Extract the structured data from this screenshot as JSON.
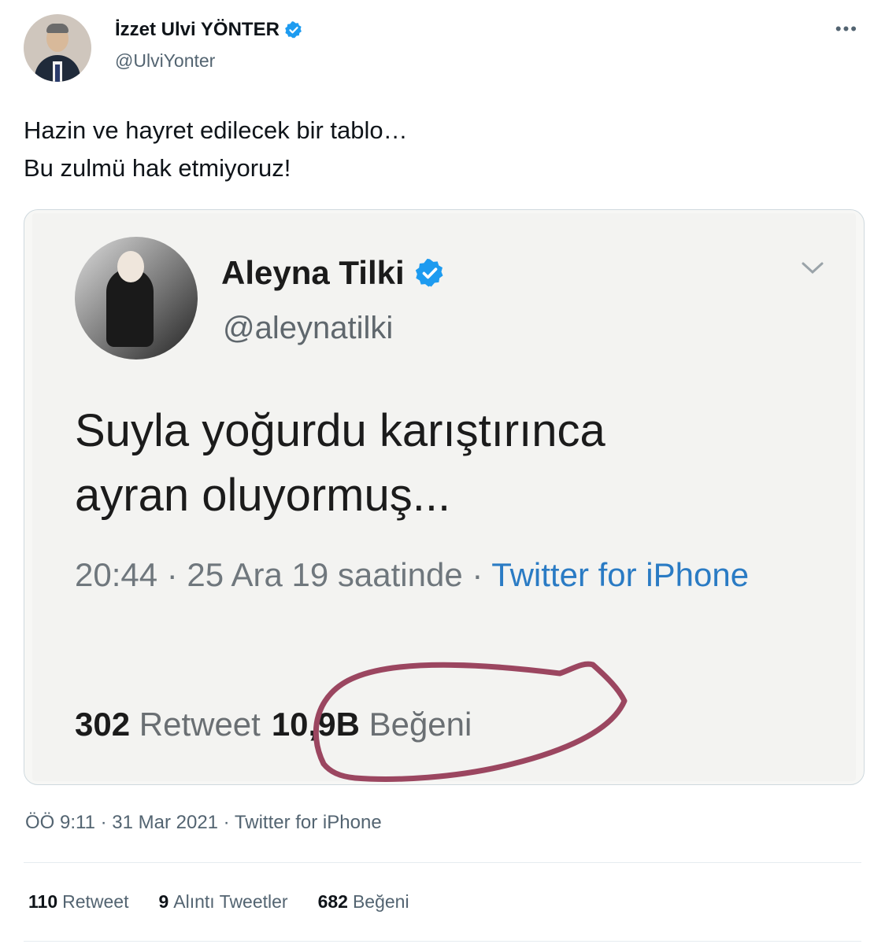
{
  "author": {
    "name": "İzzet Ulvi YÖNTER",
    "handle": "@UlviYonter"
  },
  "more_label": "•••",
  "tweet": {
    "lines": [
      "Hazin ve hayret edilecek bir tablo…",
      "Bu zulmü hak etmiyoruz!"
    ]
  },
  "embedded": {
    "name": "Aleyna Tilki",
    "handle": "@aleynatilki",
    "lines": [
      "Suyla yoğurdu karıştırınca",
      "ayran oluyormuş..."
    ],
    "time_date": "20:44 · 25 Ara 19 saatinde · ",
    "source": "Twitter for iPhone",
    "retweet_count": "302",
    "retweet_label": "Retweet",
    "like_count": "10,9B",
    "like_label": "Beğeni"
  },
  "meta": {
    "timestamp": "ÖÖ 9:11 · 31 Mar 2021 · Twitter for iPhone"
  },
  "stats": {
    "retweets": "110",
    "retweets_label": "Retweet",
    "quotes": "9",
    "quotes_label": "Alıntı Tweetler",
    "likes": "682",
    "likes_label": "Beğeni"
  },
  "colors": {
    "verified": "#1d9bf0",
    "circle": "#9b4660"
  }
}
